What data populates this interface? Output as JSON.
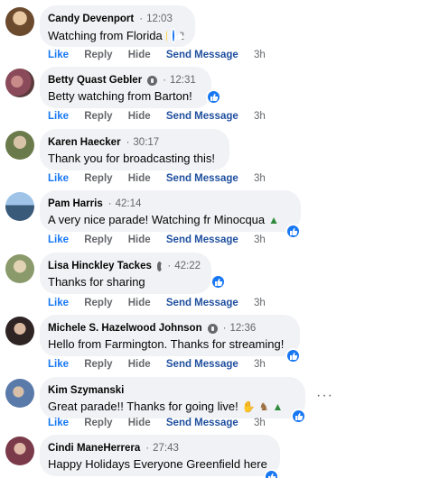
{
  "comments": [
    {
      "author": "Candy Devenport",
      "badge": false,
      "time": "12:03",
      "text": "Watching from Florida",
      "emojis": [
        "sun-emoji"
      ],
      "reaction_count": "2",
      "actions": {
        "like": "Like",
        "reply": "Reply",
        "hide": "Hide",
        "send": "Send Message",
        "ago": "3h"
      },
      "avatar_color": "#7a5a3a"
    },
    {
      "author": "Betty Quast Gebler",
      "badge": true,
      "time": "12:31",
      "text": "Betty watching from Barton!",
      "emojis": [],
      "reaction_count": "",
      "actions": {
        "like": "Like",
        "reply": "Reply",
        "hide": "Hide",
        "send": "Send Message",
        "ago": "3h"
      },
      "avatar_color": "#8a4a5a"
    },
    {
      "author": "Karen Haecker",
      "badge": false,
      "time": "30:17",
      "text": "Thank you for broadcasting this!",
      "emojis": [],
      "reaction_count": "",
      "actions": {
        "like": "Like",
        "reply": "Reply",
        "hide": "Hide",
        "send": "Send Message",
        "ago": "3h"
      },
      "avatar_color": "#6b7a4a"
    },
    {
      "author": "Pam Harris",
      "badge": false,
      "time": "42:14",
      "text": "A very nice parade! Watching fr Minocqua",
      "emojis": [
        "tree-emoji"
      ],
      "reaction_count": "",
      "actions": {
        "like": "Like",
        "reply": "Reply",
        "hide": "Hide",
        "send": "Send Message",
        "ago": "3h"
      },
      "avatar_color": "#3a5a7a"
    },
    {
      "author": "Lisa Hinckley Tackes",
      "badge": true,
      "time": "42:22",
      "text": "Thanks for sharing",
      "emojis": [],
      "reaction_count": "",
      "actions": {
        "like": "Like",
        "reply": "Reply",
        "hide": "Hide",
        "send": "Send Message",
        "ago": "3h"
      },
      "avatar_color": "#8a9a6a"
    },
    {
      "author": "Michele S. Hazelwood Johnson",
      "badge": true,
      "time": "12:36",
      "text": "Hello from Farmington. Thanks for streaming!",
      "emojis": [],
      "reaction_count": "",
      "actions": {
        "like": "Like",
        "reply": "Reply",
        "hide": "Hide",
        "send": "Send Message",
        "ago": "3h"
      },
      "avatar_color": "#4a3a3a"
    },
    {
      "author": "Kim Szymanski",
      "badge": false,
      "time": "",
      "text": "Great parade!! Thanks for going live!",
      "emojis": [
        "wave-emoji",
        "deer-emoji",
        "tree-emoji"
      ],
      "reaction_count": "",
      "actions": {
        "like": "Like",
        "reply": "Reply",
        "hide": "Hide",
        "send": "Send Message",
        "ago": "3h"
      },
      "avatar_color": "#5a7aaa"
    },
    {
      "author": "Cindi ManeHerrera",
      "badge": false,
      "time": "27:43",
      "text": "Happy Holidays Everyone Greenfield here",
      "emojis": [],
      "reaction_count": "",
      "actions": {
        "like": "",
        "reply": "",
        "hide": "",
        "send": "",
        "ago": ""
      },
      "avatar_color": "#7a3a4a"
    }
  ],
  "colors": {
    "like_blue": "#1877f2",
    "bubble_bg": "#f0f2f5",
    "meta_gray": "#65676b"
  }
}
